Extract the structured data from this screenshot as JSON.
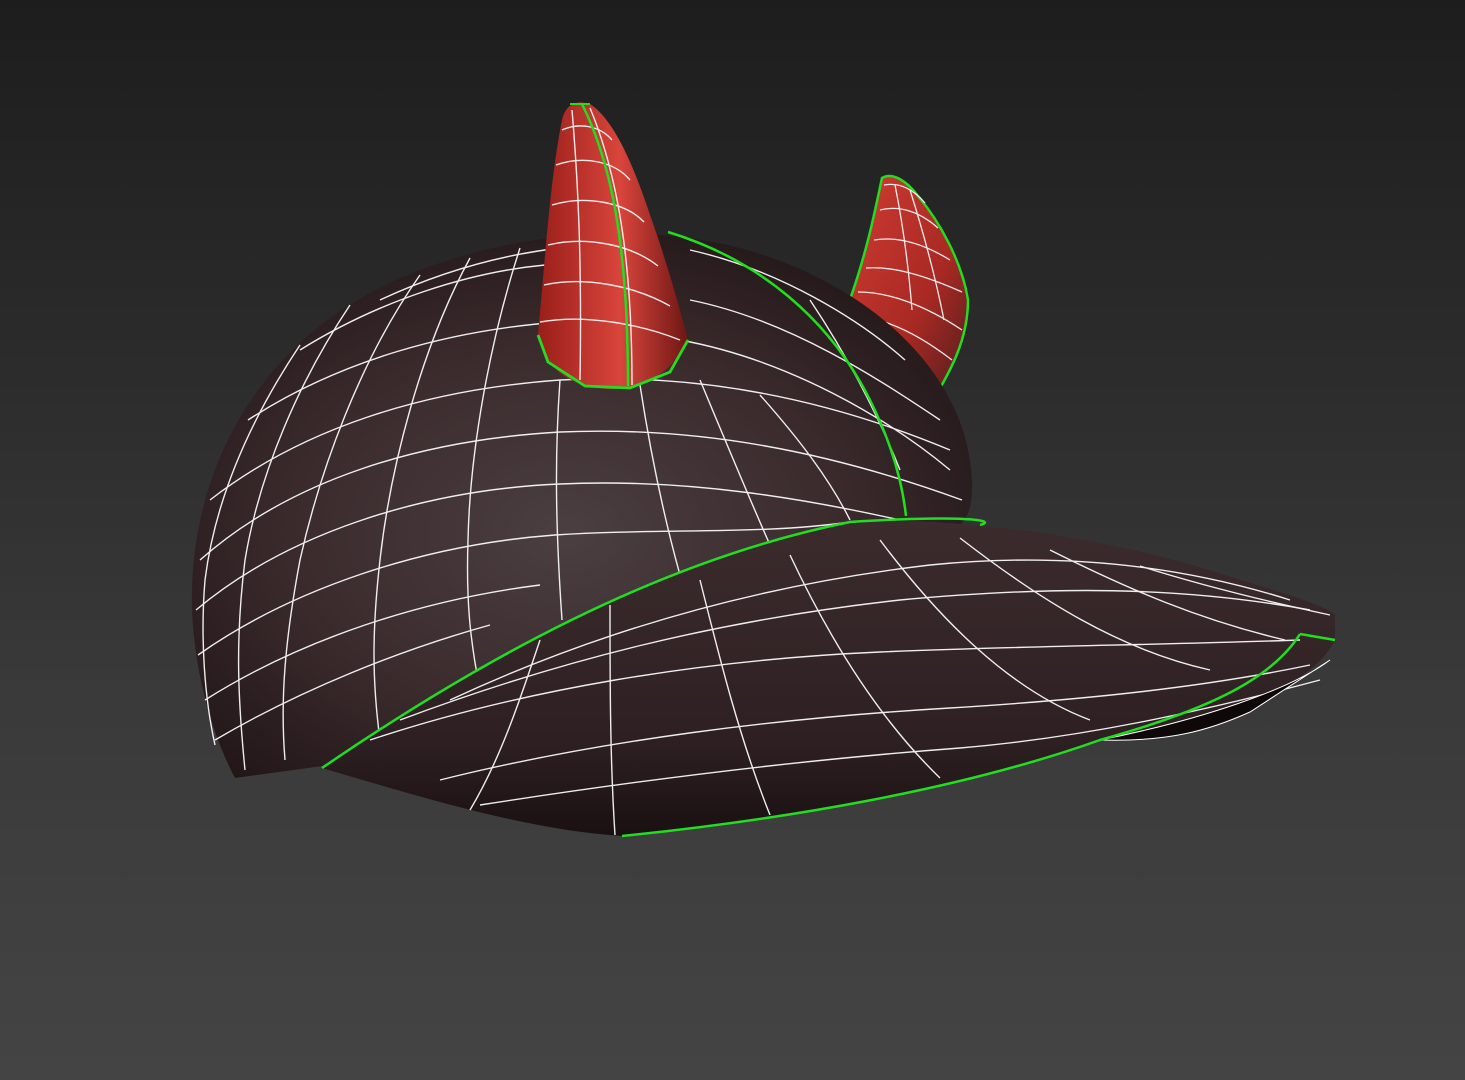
{
  "viewport": {
    "background_top": "#1d1d1d",
    "background_bottom": "#444444"
  },
  "model": {
    "object": "devil-horn-cap-icon",
    "cap_color": "#3a2626",
    "horn_color": "#c8322a",
    "wire_color": "#ffffff",
    "selection_color": "#22dd22"
  }
}
